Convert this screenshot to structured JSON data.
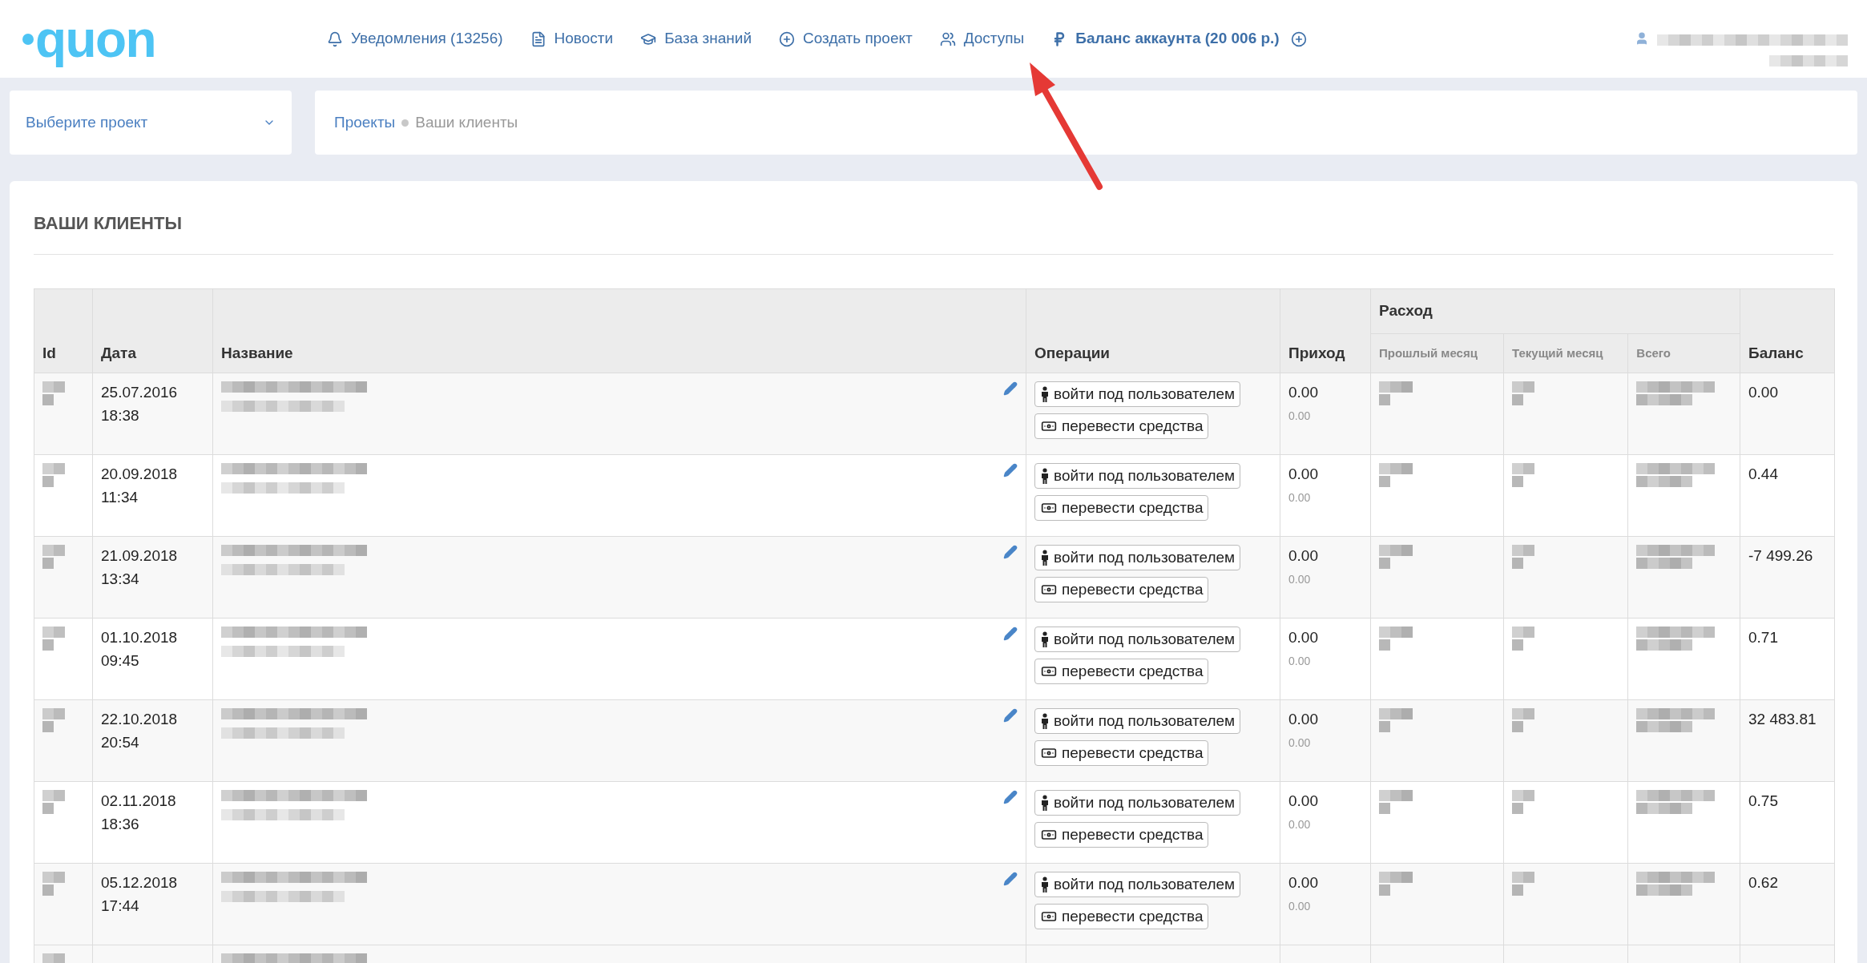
{
  "logo": "quon",
  "nav": [
    {
      "kind": "bell",
      "label": "Уведомления (13256)"
    },
    {
      "kind": "file",
      "label": "Новости"
    },
    {
      "kind": "cap",
      "label": "База знаний"
    },
    {
      "kind": "plus",
      "label": "Создать проект"
    },
    {
      "kind": "users",
      "label": "Доступы"
    },
    {
      "kind": "balance",
      "label": "Баланс аккаунта (20 006 р.)"
    }
  ],
  "project_select": {
    "placeholder": "Выберите проект"
  },
  "breadcrumb": [
    {
      "label": "Проекты",
      "selected": false
    },
    {
      "label": "Ваши клиенты",
      "selected": true
    }
  ],
  "section_title": "ВАШИ КЛИЕНТЫ",
  "table": {
    "columns": {
      "id": "Id",
      "date": "Дата",
      "name": "Название",
      "operations": "Операции",
      "income": "Приход",
      "expense": "Расход",
      "last_month": "Прошлый месяц",
      "this_month": "Текущий месяц",
      "total": "Всего",
      "balance": "Баланс"
    },
    "rows": [
      {
        "date": "25.07.2016",
        "time": "18:38",
        "operations": [
          "войти под пользователем",
          "перевести средства"
        ],
        "income": "0.00",
        "income_note": "0.00",
        "balance": "0.00"
      },
      {
        "date": "20.09.2018",
        "time": "11:34",
        "operations": [
          "войти под пользователем",
          "перевести средства"
        ],
        "income": "0.00",
        "income_note": "0.00",
        "balance": "0.44"
      },
      {
        "date": "21.09.2018",
        "time": "13:34",
        "operations": [
          "войти под пользователем",
          "перевести средства"
        ],
        "income": "0.00",
        "income_note": "0.00",
        "balance": "-7 499.26"
      },
      {
        "date": "01.10.2018",
        "time": "09:45",
        "operations": [
          "войти под пользователем",
          "перевести средства"
        ],
        "income": "0.00",
        "income_note": "0.00",
        "balance": "0.71"
      },
      {
        "date": "22.10.2018",
        "time": "20:54",
        "operations": [
          "войти под пользователем",
          "перевести средства"
        ],
        "income": "0.00",
        "income_note": "0.00",
        "balance": "32 483.81"
      },
      {
        "date": "02.11.2018",
        "time": "18:36",
        "operations": [
          "войти под пользователем",
          "перевести средства"
        ],
        "income": "0.00",
        "income_note": "0.00",
        "balance": "0.75"
      },
      {
        "date": "05.12.2018",
        "time": "17:44",
        "operations": [
          "войти под пользователем",
          "перевести средства"
        ],
        "income": "0.00",
        "income_note": "0.00",
        "balance": "0.62"
      }
    ]
  }
}
